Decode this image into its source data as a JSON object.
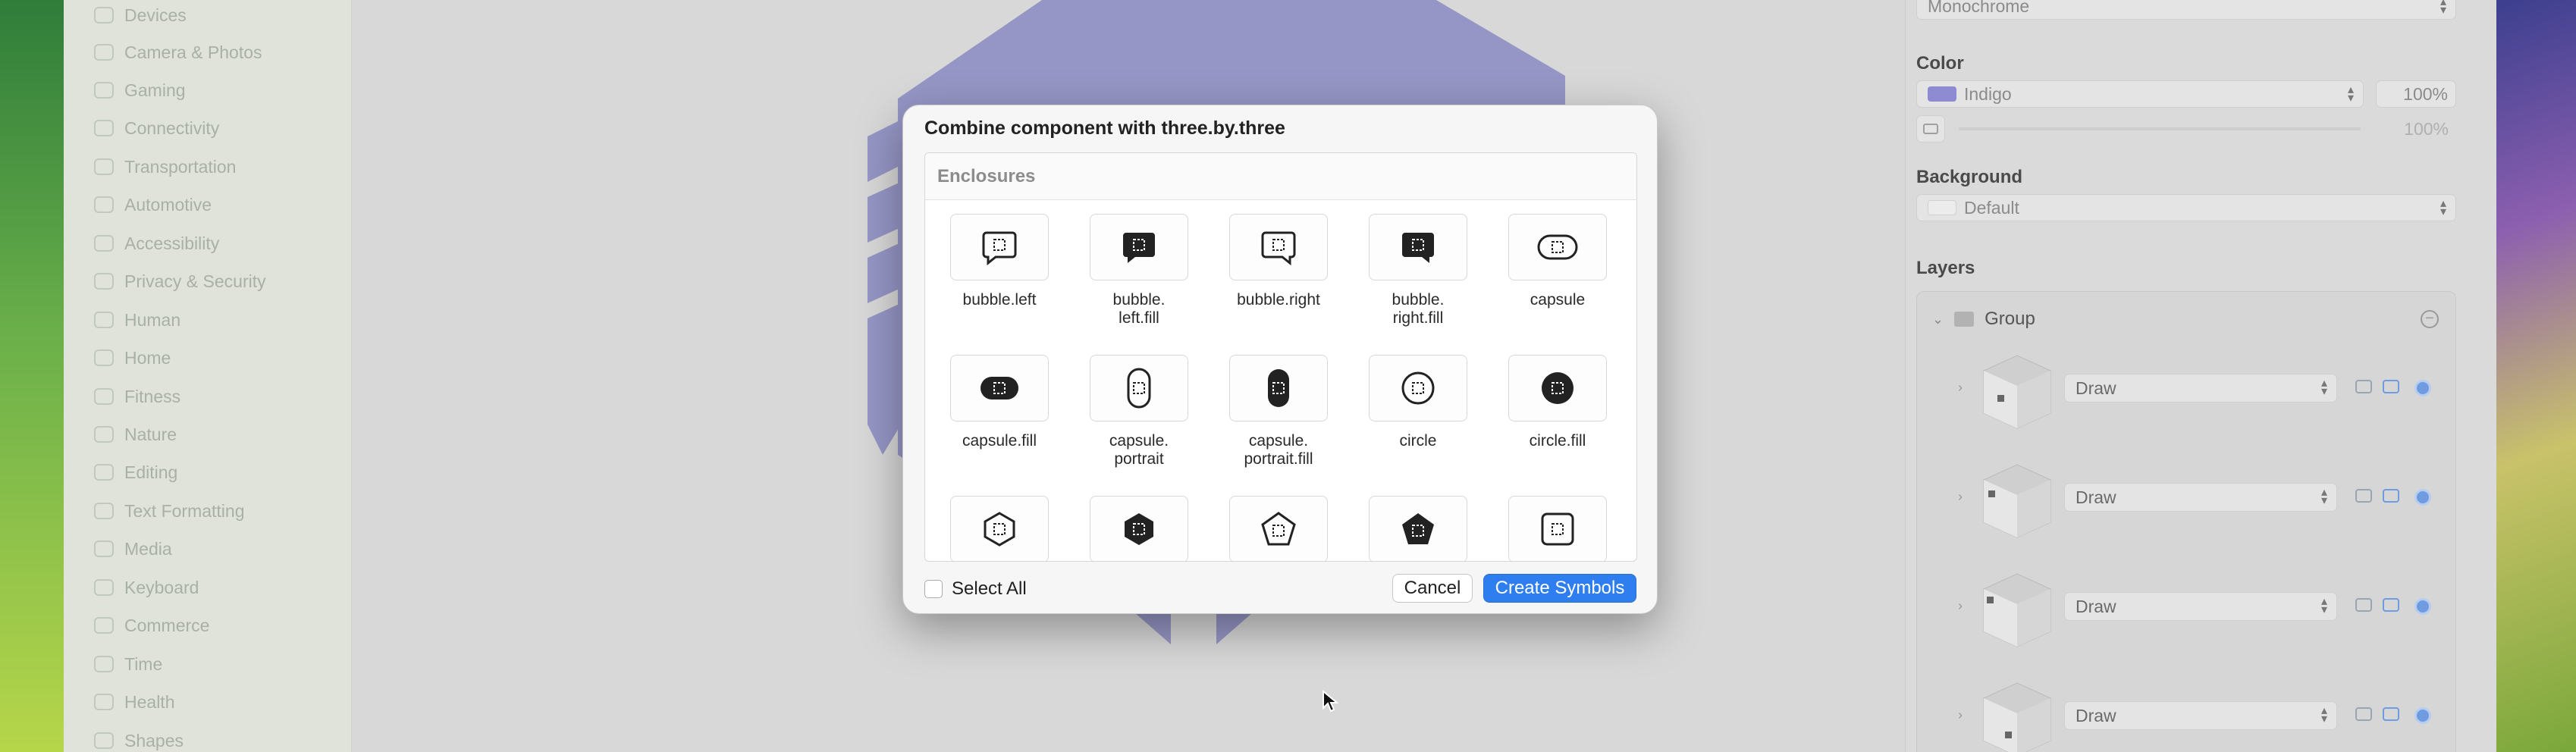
{
  "sidebar": {
    "items": [
      {
        "label": "Devices",
        "icon": "devices-icon"
      },
      {
        "label": "Camera & Photos",
        "icon": "camera-icon"
      },
      {
        "label": "Gaming",
        "icon": "gamecontroller-icon"
      },
      {
        "label": "Connectivity",
        "icon": "connectivity-icon"
      },
      {
        "label": "Transportation",
        "icon": "car-icon"
      },
      {
        "label": "Automotive",
        "icon": "automotive-icon"
      },
      {
        "label": "Accessibility",
        "icon": "accessibility-icon"
      },
      {
        "label": "Privacy & Security",
        "icon": "lock-icon"
      },
      {
        "label": "Human",
        "icon": "person-icon"
      },
      {
        "label": "Home",
        "icon": "house-icon"
      },
      {
        "label": "Fitness",
        "icon": "figure-icon"
      },
      {
        "label": "Nature",
        "icon": "leaf-icon"
      },
      {
        "label": "Editing",
        "icon": "pencil-icon"
      },
      {
        "label": "Text Formatting",
        "icon": "textformat-icon"
      },
      {
        "label": "Media",
        "icon": "media-icon"
      },
      {
        "label": "Keyboard",
        "icon": "command-icon"
      },
      {
        "label": "Commerce",
        "icon": "cart-icon"
      },
      {
        "label": "Time",
        "icon": "clock-icon"
      },
      {
        "label": "Health",
        "icon": "heart-icon"
      },
      {
        "label": "Shapes",
        "icon": "shapes-icon"
      }
    ]
  },
  "inspector": {
    "rendering_value": "Monochrome",
    "color_label": "Color",
    "color_value": "Indigo",
    "color_swatch": "#8e8bd2",
    "color_percent": "100%",
    "secondary_percent": "100%",
    "background_label": "Background",
    "background_value": "Default",
    "layers_label": "Layers",
    "group_label": "Group",
    "layers": [
      {
        "mode": "Draw"
      },
      {
        "mode": "Draw"
      },
      {
        "mode": "Draw"
      },
      {
        "mode": "Draw"
      }
    ]
  },
  "dialog": {
    "title": "Combine component with three.by.three",
    "section": "Enclosures",
    "symbols": [
      {
        "name": "bubble.left",
        "icon": "bubble-left-icon"
      },
      {
        "name": "bubble.\nleft.fill",
        "icon": "bubble-left-fill-icon"
      },
      {
        "name": "bubble.right",
        "icon": "bubble-right-icon"
      },
      {
        "name": "bubble.\nright.fill",
        "icon": "bubble-right-fill-icon"
      },
      {
        "name": "capsule",
        "icon": "capsule-icon"
      },
      {
        "name": "capsule.fill",
        "icon": "capsule-fill-icon"
      },
      {
        "name": "capsule.\nportrait",
        "icon": "capsule-portrait-icon"
      },
      {
        "name": "capsule.\nportrait.fill",
        "icon": "capsule-portrait-fill-icon"
      },
      {
        "name": "circle",
        "icon": "circle-icon"
      },
      {
        "name": "circle.fill",
        "icon": "circle-fill-icon"
      },
      {
        "name": "",
        "icon": "hexagon-icon"
      },
      {
        "name": "",
        "icon": "hexagon-fill-icon"
      },
      {
        "name": "",
        "icon": "pentagon-icon"
      },
      {
        "name": "",
        "icon": "pentagon-fill-icon"
      },
      {
        "name": "",
        "icon": "square-icon"
      }
    ],
    "select_all_label": "Select All",
    "cancel_label": "Cancel",
    "create_label": "Create Symbols",
    "accent": "#2f7ef0"
  }
}
